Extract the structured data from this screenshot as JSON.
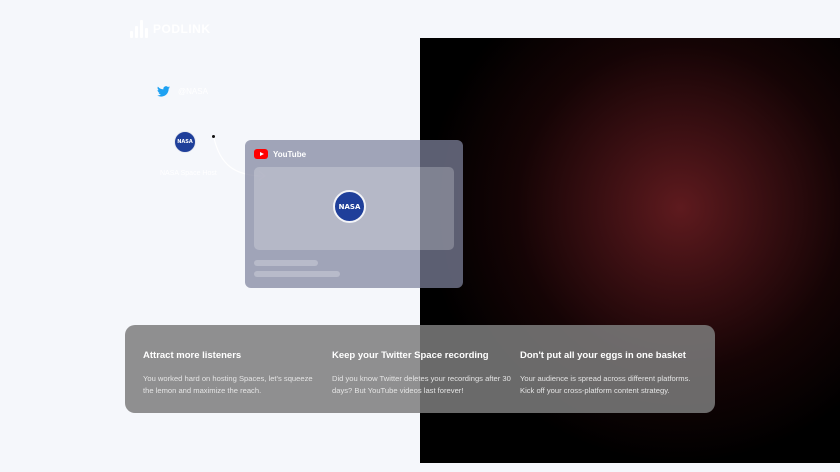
{
  "brand": {
    "name": "PODLINK",
    "accent": "#ffffff"
  },
  "twitter": {
    "icon": "twitter-bird-icon",
    "handle": "@NASA",
    "color": "#1da1f2"
  },
  "speaker": {
    "avatar_text": "NASA",
    "name": "NASA Space Host"
  },
  "youtube": {
    "icon": "youtube-play-icon",
    "title": "YouTube",
    "thumb_avatar_text": "NASA",
    "color": "#ff0000"
  },
  "features": [
    {
      "title": "Attract more listeners",
      "mark": "",
      "body": "You worked hard on hosting Spaces, let's squeeze the lemon and maximize the reach."
    },
    {
      "title": "Keep your Twitter Space recording",
      "mark": "",
      "body": "Did you know Twitter deletes your recordings after 30 days? But YouTube videos last forever!"
    },
    {
      "title": "Don't put all your eggs in one basket",
      "mark": "",
      "body": "Your audience is spread across different platforms. Kick off your cross-platform content strategy."
    }
  ]
}
